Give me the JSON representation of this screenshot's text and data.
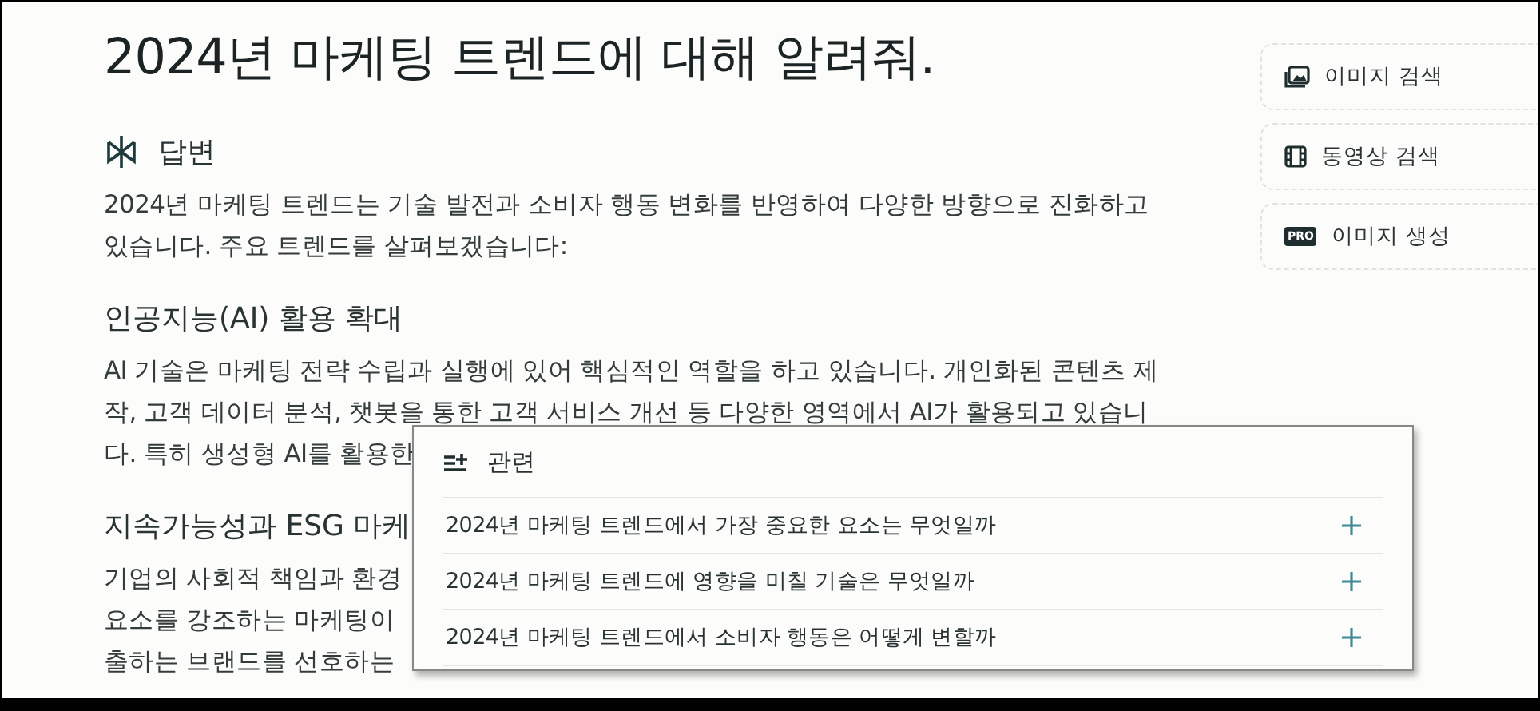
{
  "question": "2024년 마케팅 트렌드에 대해 알려줘.",
  "answer": {
    "label": "답변",
    "intro": [
      "2024년 마케팅 트렌드는 기술 발전과 소비자 행동 변화를 반영하여 다양한 방향으로 진화하고",
      "있습니다. 주요 트렌드를 살펴보겠습니다:"
    ],
    "sections": [
      {
        "heading": "인공지능(AI) 활용 확대",
        "lines": [
          "AI 기술은 마케팅 전략 수립과 실행에 있어 핵심적인 역할을 하고 있습니다. 개인화된 콘텐츠 제",
          "작, 고객 데이터 분석, 챗봇을 통한 고객 서비스 개선 등 다양한 영역에서 AI가 활용되고 있습니",
          "다. 특히 생성형 AI를 활용한"
        ]
      },
      {
        "heading": "지속가능성과 ESG 마케",
        "lines": [
          "기업의 사회적 책임과 환경",
          "요소를 강조하는 마케팅이",
          "출하는 브랜드를 선호하는"
        ]
      }
    ]
  },
  "side_actions": [
    {
      "kind": "image",
      "label": "이미지 검색"
    },
    {
      "kind": "video",
      "label": "동영상 검색"
    },
    {
      "kind": "pro",
      "badge": "PRO",
      "label": "이미지 생성"
    }
  ],
  "related": {
    "title": "관련",
    "items": [
      "2024년 마케팅 트렌드에서 가장 중요한 요소는 무엇일까",
      "2024년 마케팅 트렌드에 영향을 미칠 기술은 무엇일까",
      "2024년 마케팅 트렌드에서 소비자 행동은 어떻게 변할까"
    ]
  }
}
